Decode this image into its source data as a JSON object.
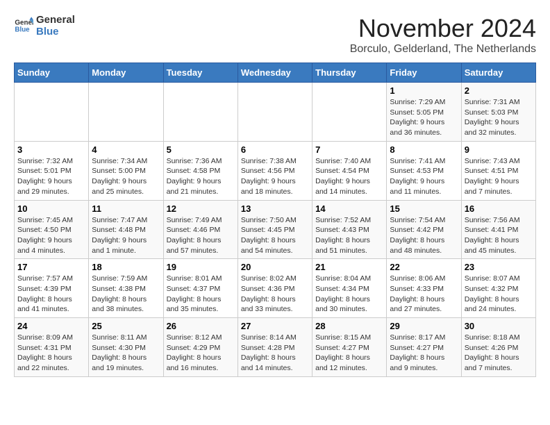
{
  "header": {
    "logo_line1": "General",
    "logo_line2": "Blue",
    "month_title": "November 2024",
    "subtitle": "Borculo, Gelderland, The Netherlands"
  },
  "weekdays": [
    "Sunday",
    "Monday",
    "Tuesday",
    "Wednesday",
    "Thursday",
    "Friday",
    "Saturday"
  ],
  "weeks": [
    [
      {
        "day": "",
        "info": ""
      },
      {
        "day": "",
        "info": ""
      },
      {
        "day": "",
        "info": ""
      },
      {
        "day": "",
        "info": ""
      },
      {
        "day": "",
        "info": ""
      },
      {
        "day": "1",
        "info": "Sunrise: 7:29 AM\nSunset: 5:05 PM\nDaylight: 9 hours and 36 minutes."
      },
      {
        "day": "2",
        "info": "Sunrise: 7:31 AM\nSunset: 5:03 PM\nDaylight: 9 hours and 32 minutes."
      }
    ],
    [
      {
        "day": "3",
        "info": "Sunrise: 7:32 AM\nSunset: 5:01 PM\nDaylight: 9 hours and 29 minutes."
      },
      {
        "day": "4",
        "info": "Sunrise: 7:34 AM\nSunset: 5:00 PM\nDaylight: 9 hours and 25 minutes."
      },
      {
        "day": "5",
        "info": "Sunrise: 7:36 AM\nSunset: 4:58 PM\nDaylight: 9 hours and 21 minutes."
      },
      {
        "day": "6",
        "info": "Sunrise: 7:38 AM\nSunset: 4:56 PM\nDaylight: 9 hours and 18 minutes."
      },
      {
        "day": "7",
        "info": "Sunrise: 7:40 AM\nSunset: 4:54 PM\nDaylight: 9 hours and 14 minutes."
      },
      {
        "day": "8",
        "info": "Sunrise: 7:41 AM\nSunset: 4:53 PM\nDaylight: 9 hours and 11 minutes."
      },
      {
        "day": "9",
        "info": "Sunrise: 7:43 AM\nSunset: 4:51 PM\nDaylight: 9 hours and 7 minutes."
      }
    ],
    [
      {
        "day": "10",
        "info": "Sunrise: 7:45 AM\nSunset: 4:50 PM\nDaylight: 9 hours and 4 minutes."
      },
      {
        "day": "11",
        "info": "Sunrise: 7:47 AM\nSunset: 4:48 PM\nDaylight: 9 hours and 1 minute."
      },
      {
        "day": "12",
        "info": "Sunrise: 7:49 AM\nSunset: 4:46 PM\nDaylight: 8 hours and 57 minutes."
      },
      {
        "day": "13",
        "info": "Sunrise: 7:50 AM\nSunset: 4:45 PM\nDaylight: 8 hours and 54 minutes."
      },
      {
        "day": "14",
        "info": "Sunrise: 7:52 AM\nSunset: 4:43 PM\nDaylight: 8 hours and 51 minutes."
      },
      {
        "day": "15",
        "info": "Sunrise: 7:54 AM\nSunset: 4:42 PM\nDaylight: 8 hours and 48 minutes."
      },
      {
        "day": "16",
        "info": "Sunrise: 7:56 AM\nSunset: 4:41 PM\nDaylight: 8 hours and 45 minutes."
      }
    ],
    [
      {
        "day": "17",
        "info": "Sunrise: 7:57 AM\nSunset: 4:39 PM\nDaylight: 8 hours and 41 minutes."
      },
      {
        "day": "18",
        "info": "Sunrise: 7:59 AM\nSunset: 4:38 PM\nDaylight: 8 hours and 38 minutes."
      },
      {
        "day": "19",
        "info": "Sunrise: 8:01 AM\nSunset: 4:37 PM\nDaylight: 8 hours and 35 minutes."
      },
      {
        "day": "20",
        "info": "Sunrise: 8:02 AM\nSunset: 4:36 PM\nDaylight: 8 hours and 33 minutes."
      },
      {
        "day": "21",
        "info": "Sunrise: 8:04 AM\nSunset: 4:34 PM\nDaylight: 8 hours and 30 minutes."
      },
      {
        "day": "22",
        "info": "Sunrise: 8:06 AM\nSunset: 4:33 PM\nDaylight: 8 hours and 27 minutes."
      },
      {
        "day": "23",
        "info": "Sunrise: 8:07 AM\nSunset: 4:32 PM\nDaylight: 8 hours and 24 minutes."
      }
    ],
    [
      {
        "day": "24",
        "info": "Sunrise: 8:09 AM\nSunset: 4:31 PM\nDaylight: 8 hours and 22 minutes."
      },
      {
        "day": "25",
        "info": "Sunrise: 8:11 AM\nSunset: 4:30 PM\nDaylight: 8 hours and 19 minutes."
      },
      {
        "day": "26",
        "info": "Sunrise: 8:12 AM\nSunset: 4:29 PM\nDaylight: 8 hours and 16 minutes."
      },
      {
        "day": "27",
        "info": "Sunrise: 8:14 AM\nSunset: 4:28 PM\nDaylight: 8 hours and 14 minutes."
      },
      {
        "day": "28",
        "info": "Sunrise: 8:15 AM\nSunset: 4:27 PM\nDaylight: 8 hours and 12 minutes."
      },
      {
        "day": "29",
        "info": "Sunrise: 8:17 AM\nSunset: 4:27 PM\nDaylight: 8 hours and 9 minutes."
      },
      {
        "day": "30",
        "info": "Sunrise: 8:18 AM\nSunset: 4:26 PM\nDaylight: 8 hours and 7 minutes."
      }
    ]
  ]
}
